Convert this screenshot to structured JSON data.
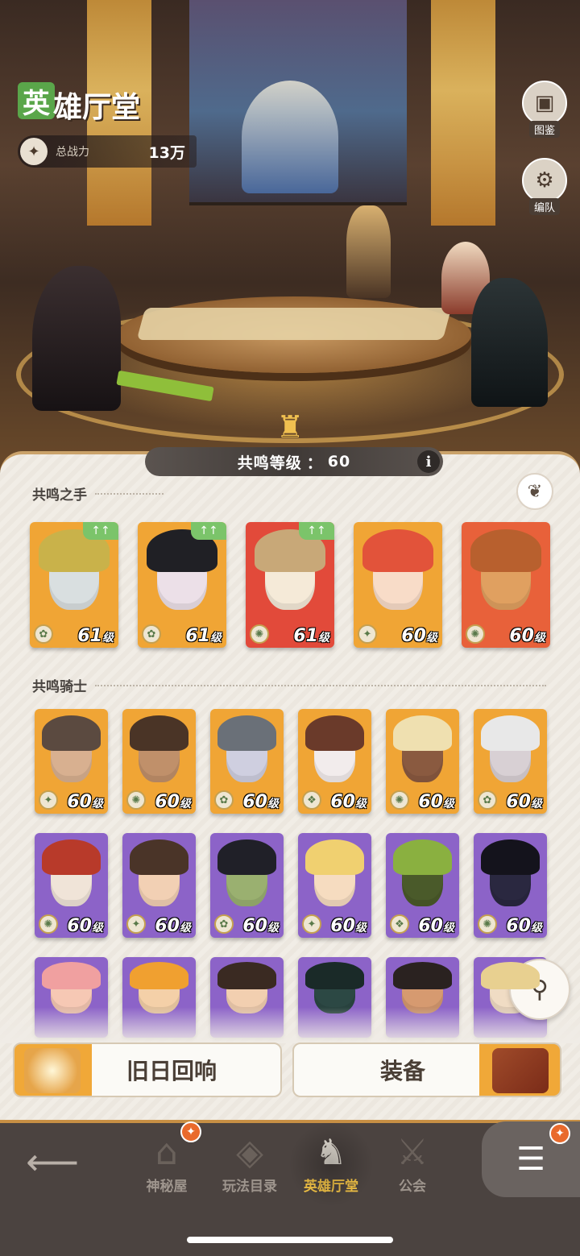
{
  "header": {
    "title_badge_char": "英",
    "title_rest": "雄厅堂",
    "power_label": "总战力",
    "power_value": "13万"
  },
  "side_buttons": [
    {
      "label": "图鉴",
      "icon": "book-icon"
    },
    {
      "label": "编队",
      "icon": "team-icon"
    }
  ],
  "resonance": {
    "label": "共鸣等级",
    "separator": "：",
    "value": "60"
  },
  "sections": {
    "hands_title": "共鸣之手",
    "knights_title": "共鸣骑士"
  },
  "resonance_hands": [
    {
      "level": "61",
      "unit": "级",
      "upgrade": "↑↑",
      "faction": "✿",
      "bg": "#f0a535",
      "skin": "#d9dfe0",
      "hair": "#c9b24a"
    },
    {
      "level": "61",
      "unit": "级",
      "upgrade": "↑↑",
      "faction": "✿",
      "bg": "#f0a535",
      "skin": "#ece0e8",
      "hair": "#202025"
    },
    {
      "level": "61",
      "unit": "级",
      "upgrade": "↑↑",
      "faction": "✺",
      "bg": "#e24a3a",
      "skin": "#f5ead8",
      "hair": "#c8a878"
    },
    {
      "level": "60",
      "unit": "级",
      "upgrade": "",
      "faction": "✦",
      "bg": "#f0a535",
      "skin": "#f8dcc8",
      "hair": "#e2533a"
    },
    {
      "level": "60",
      "unit": "级",
      "upgrade": "",
      "faction": "✺",
      "bg": "#e8613a",
      "skin": "#e0a060",
      "hair": "#b8602e"
    }
  ],
  "resonance_knights": [
    {
      "level": "60",
      "unit": "级",
      "faction": "✦",
      "bg": "#f0a535",
      "skin": "#d8b090",
      "hair": "#5b4a40"
    },
    {
      "level": "60",
      "unit": "级",
      "faction": "✺",
      "bg": "#f0a535",
      "skin": "#c0906a",
      "hair": "#4a3426"
    },
    {
      "level": "60",
      "unit": "级",
      "faction": "✿",
      "bg": "#f0a535",
      "skin": "#cfcfe0",
      "hair": "#6a7078"
    },
    {
      "level": "60",
      "unit": "级",
      "faction": "❖",
      "bg": "#f0a535",
      "skin": "#f2ecec",
      "hair": "#6a3a2a"
    },
    {
      "level": "60",
      "unit": "级",
      "faction": "✺",
      "bg": "#f0a535",
      "skin": "#8a5a40",
      "hair": "#efe0b0"
    },
    {
      "level": "60",
      "unit": "级",
      "faction": "✿",
      "bg": "#f0a535",
      "skin": "#d8d0d4",
      "hair": "#e8e8e8"
    },
    {
      "level": "60",
      "unit": "级",
      "faction": "✺",
      "bg": "#8c63c8",
      "skin": "#f0e4d8",
      "hair": "#b83a2a"
    },
    {
      "level": "60",
      "unit": "级",
      "faction": "✦",
      "bg": "#8c63c8",
      "skin": "#f2d0b4",
      "hair": "#4a3428"
    },
    {
      "level": "60",
      "unit": "级",
      "faction": "✿",
      "bg": "#8c63c8",
      "skin": "#9ab070",
      "hair": "#202028"
    },
    {
      "level": "60",
      "unit": "级",
      "faction": "✦",
      "bg": "#8c63c8",
      "skin": "#f6dcc0",
      "hair": "#f0d070"
    },
    {
      "level": "60",
      "unit": "级",
      "faction": "❖",
      "bg": "#8c63c8",
      "skin": "#4a5a2a",
      "hair": "#8ab040"
    },
    {
      "level": "60",
      "unit": "级",
      "faction": "✺",
      "bg": "#8c63c8",
      "skin": "#2a2840",
      "hair": "#14131c"
    },
    {
      "level": "",
      "unit": "",
      "faction": "",
      "bg": "#8c63c8",
      "skin": "#f6c8b4",
      "hair": "#f0a0a0"
    },
    {
      "level": "",
      "unit": "",
      "faction": "",
      "bg": "#8c63c8",
      "skin": "#f4d0a8",
      "hair": "#f0a030"
    },
    {
      "level": "",
      "unit": "",
      "faction": "",
      "bg": "#8c63c8",
      "skin": "#f2cfb0",
      "hair": "#3a2a22"
    },
    {
      "level": "",
      "unit": "",
      "faction": "",
      "bg": "#8c63c8",
      "skin": "#2c4844",
      "hair": "#1a2a28"
    },
    {
      "level": "",
      "unit": "",
      "faction": "",
      "bg": "#8c63c8",
      "skin": "#d69a70",
      "hair": "#2a2220"
    },
    {
      "level": "",
      "unit": "",
      "faction": "",
      "bg": "#8c63c8",
      "skin": "#f0dcc4",
      "hair": "#e8d090"
    }
  ],
  "action_buttons": {
    "echoes": "旧日回响",
    "equipment": "装备"
  },
  "bottom_nav": {
    "items": [
      {
        "label": "神秘屋",
        "icon": "mystery-house-icon",
        "glyph": "⌂",
        "gift": true
      },
      {
        "label": "玩法目录",
        "icon": "catalog-icon",
        "glyph": "◈",
        "gift": false
      },
      {
        "label": "英雄厅堂",
        "icon": "helmet-icon",
        "glyph": "♞",
        "gift": false
      },
      {
        "label": "公会",
        "icon": "guild-icon",
        "glyph": "⚔",
        "gift": false
      }
    ],
    "active": "英雄厅堂"
  },
  "colors": {
    "accent_gold": "#f3c346",
    "panel_bg": "#f1ede6",
    "nav_bg": "#4b4340",
    "upgrade_green": "#7bc46a"
  }
}
